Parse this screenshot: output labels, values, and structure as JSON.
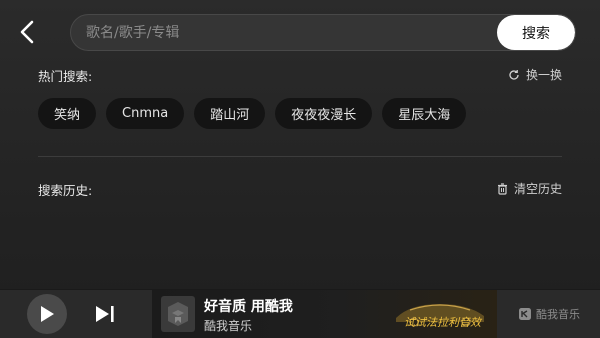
{
  "header": {
    "back_icon": "chevron-left-icon",
    "search_placeholder": "歌名/歌手/专辑",
    "search_button_label": "搜索"
  },
  "hot": {
    "title": "热门搜索:",
    "refresh_label": "换一换",
    "refresh_icon": "refresh-icon",
    "tags": [
      "笑纳",
      "Cnmna",
      "踏山河",
      "夜夜夜漫长",
      "星辰大海"
    ]
  },
  "history": {
    "title": "搜索历史:",
    "clear_label": "清空历史",
    "clear_icon": "trash-icon"
  },
  "player": {
    "play_icon": "play-icon",
    "next_icon": "skip-next-icon",
    "ad": {
      "title": "好音质 用酷我",
      "subtitle": "酷我音乐",
      "car_text": "试试法拉利音效",
      "accent": "#f0c240"
    },
    "brand_label": "酷我音乐"
  }
}
